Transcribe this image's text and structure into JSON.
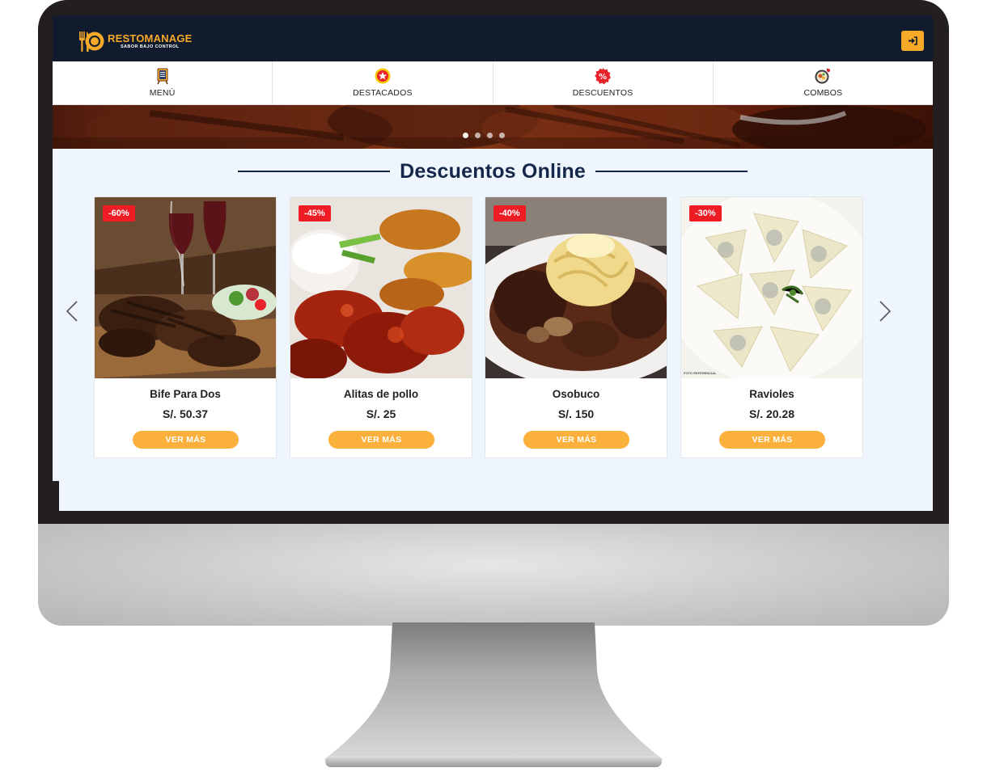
{
  "brand": {
    "name": "RESTOMANAGE",
    "tagline": "SABOR BAJO CONTROL",
    "colors": {
      "accent": "#f7a928",
      "navy": "#111b2e",
      "title": "#15274a",
      "badge": "#ee1c25",
      "button": "#fbb03b"
    }
  },
  "header": {
    "login_icon": "sign-in-icon"
  },
  "categories": [
    {
      "label": "MENÚ",
      "icon": "menu-board-icon"
    },
    {
      "label": "DESTACADOS",
      "icon": "star-badge-icon"
    },
    {
      "label": "DESCUENTOS",
      "icon": "percent-badge-icon"
    },
    {
      "label": "COMBOS",
      "icon": "combo-meal-icon"
    }
  ],
  "hero": {
    "slides": 4,
    "active_slide": 1
  },
  "section": {
    "title": "Descuentos Online"
  },
  "products": [
    {
      "name": "Bife Para Dos",
      "price": "S/. 50.37",
      "discount": "-60%",
      "button": "VER MÁS"
    },
    {
      "name": "Alitas de pollo",
      "price": "S/. 25",
      "discount": "-45%",
      "button": "VER MÁS"
    },
    {
      "name": "Osobuco",
      "price": "S/. 150",
      "discount": "-40%",
      "button": "VER MÁS"
    },
    {
      "name": "Ravioles",
      "price": "S/. 20.28",
      "discount": "-30%",
      "button": "VER MÁS",
      "image_note": "FOTO REFERENCIAL"
    }
  ],
  "carousel": {
    "prev_icon": "chevron-left-icon",
    "next_icon": "chevron-right-icon"
  }
}
